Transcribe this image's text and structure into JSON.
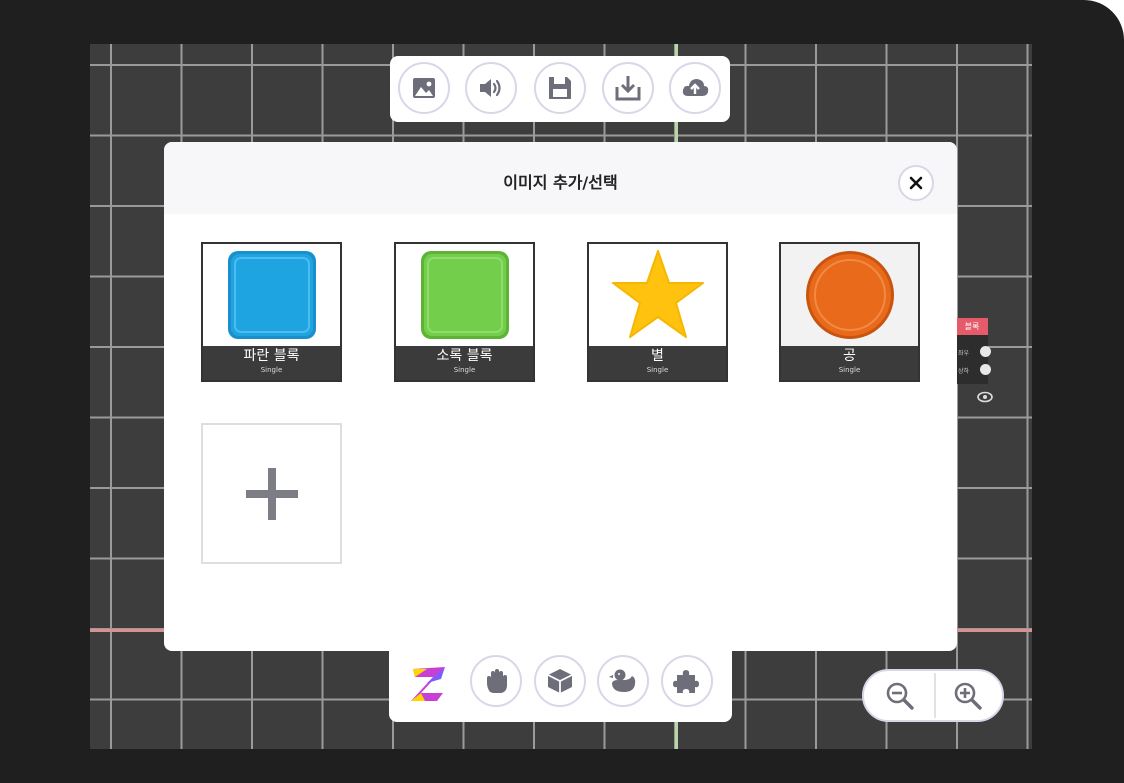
{
  "modal": {
    "title": "이미지 추가/선택",
    "assets": [
      {
        "name": "파란 블록",
        "type": "Single",
        "color": "#1fa4e2"
      },
      {
        "name": "소록 블록",
        "type": "Single",
        "color": "#73cf4b"
      },
      {
        "name": "별",
        "type": "Single",
        "color": "#ffc20e"
      },
      {
        "name": "공",
        "type": "Single",
        "color": "#e86a1a"
      }
    ]
  },
  "top_toolbar": {
    "buttons": [
      "image-icon",
      "sound-icon",
      "save-icon",
      "download-icon",
      "cloud-upload-icon"
    ]
  },
  "bottom_toolbar": {
    "buttons": [
      "logo",
      "hand-icon",
      "cube-icon",
      "duck-icon",
      "puzzle-icon"
    ]
  },
  "zoom": {
    "buttons": [
      "zoom-out-icon",
      "zoom-in-icon"
    ]
  },
  "side_panel": {
    "tag": "블록",
    "row1": "좌우",
    "row2": "상하"
  },
  "colors": {
    "accent": "#e55b6a",
    "canvas_bg": "#3d3d3d",
    "button_border": "#d7d7e8"
  }
}
